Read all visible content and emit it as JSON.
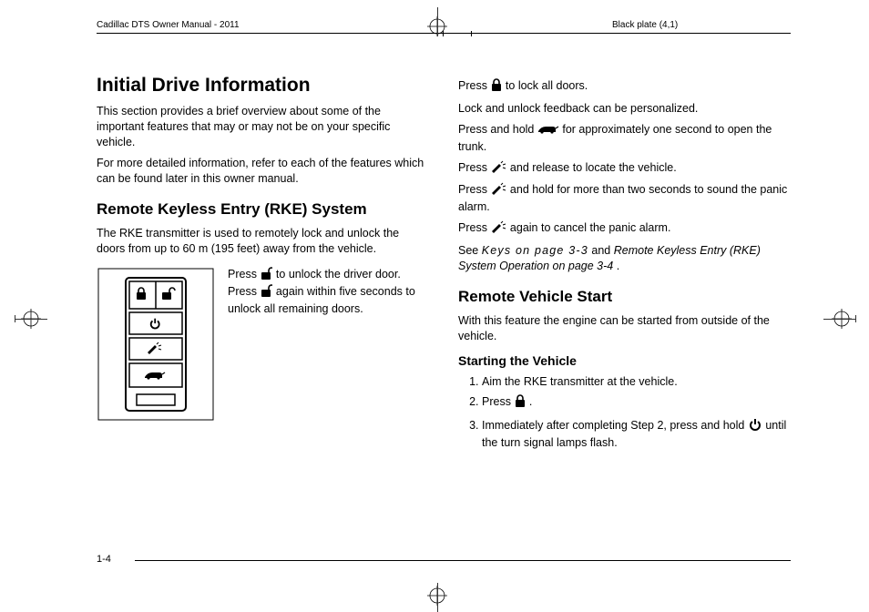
{
  "header": {
    "left": "Cadillac DTS Owner Manual - 2011",
    "right": "Black plate (4,1)"
  },
  "footer": {
    "pageNumber": "1-4"
  },
  "col1": {
    "h1": "Initial Drive Information",
    "p1": "This section provides a brief overview about some of the important features that may or may not be on your specific vehicle.",
    "p2": "For more detailed information, refer to each of the features which can be found later in this owner manual.",
    "h2": "Remote Keyless Entry (RKE) System",
    "p3": "The RKE transmitter is used to remotely lock and unlock the doors from up to 60 m (195 feet) away from the vehicle.",
    "sideText": {
      "a": "Press ",
      "b": " to unlock the driver door. Press ",
      "c": " again within five seconds to unlock all remaining doors."
    }
  },
  "col2": {
    "l1a": "Press ",
    "l1b": " to lock all doors.",
    "l2": "Lock and unlock feedback can be personalized.",
    "l3a": "Press and hold ",
    "l3b": " for approximately one second to open the trunk.",
    "l4a": "Press ",
    "l4b": " and release to locate the vehicle.",
    "l5a": "Press ",
    "l5b": " and hold for more than two seconds to sound the panic alarm.",
    "l6a": "Press ",
    "l6b": " again to cancel the panic alarm.",
    "l7a": "See ",
    "l7keys": "Keys on page 3‑3",
    "l7mid": " and ",
    "l7rke": "Remote Keyless Entry (RKE) System Operation on page 3‑4",
    "l7end": ".",
    "h2": "Remote Vehicle Start",
    "p1": "With this feature the engine can be started from outside of the vehicle.",
    "h3": "Starting the Vehicle",
    "ol": {
      "i1": "Aim the RKE transmitter at the vehicle.",
      "i2a": "Press ",
      "i2b": ".",
      "i3a": "Immediately after completing Step 2, press and hold ",
      "i3b": " until the turn signal lamps flash."
    }
  },
  "icons": {
    "lock": "lock-icon",
    "unlock": "unlock-icon",
    "trunk": "trunk-icon",
    "horn": "horn-icon",
    "remoteStart": "remote-start-icon"
  }
}
